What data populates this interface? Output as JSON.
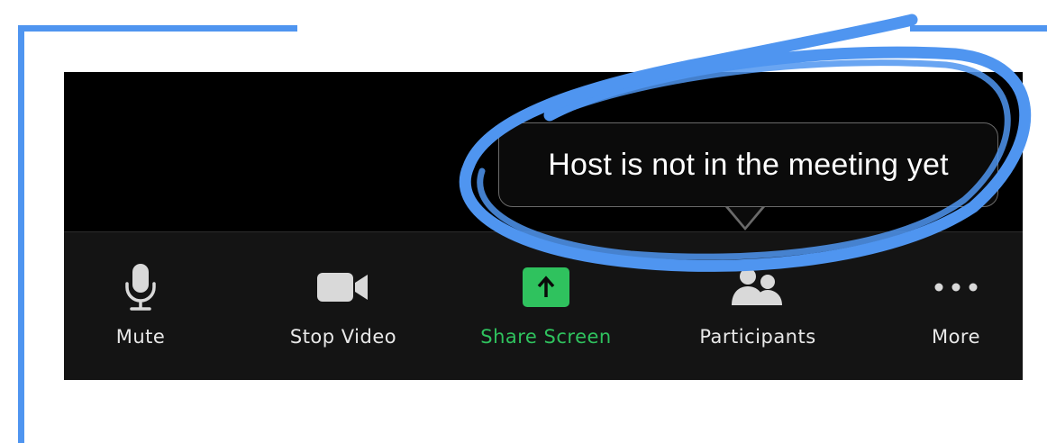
{
  "tooltip": {
    "text": "Host is not in the meeting yet"
  },
  "toolbar": {
    "items": [
      {
        "label": "Mute",
        "icon": "microphone-icon"
      },
      {
        "label": "Stop Video",
        "icon": "video-camera-icon"
      },
      {
        "label": "Share Screen",
        "icon": "share-screen-icon"
      },
      {
        "label": "Participants",
        "icon": "participants-icon"
      },
      {
        "label": "More",
        "icon": "more-dots-icon"
      }
    ]
  },
  "colors": {
    "share_green": "#2fc25e",
    "annotation_blue": "#4f95f0",
    "toolbar_bg": "#141414",
    "window_bg": "#000000"
  }
}
